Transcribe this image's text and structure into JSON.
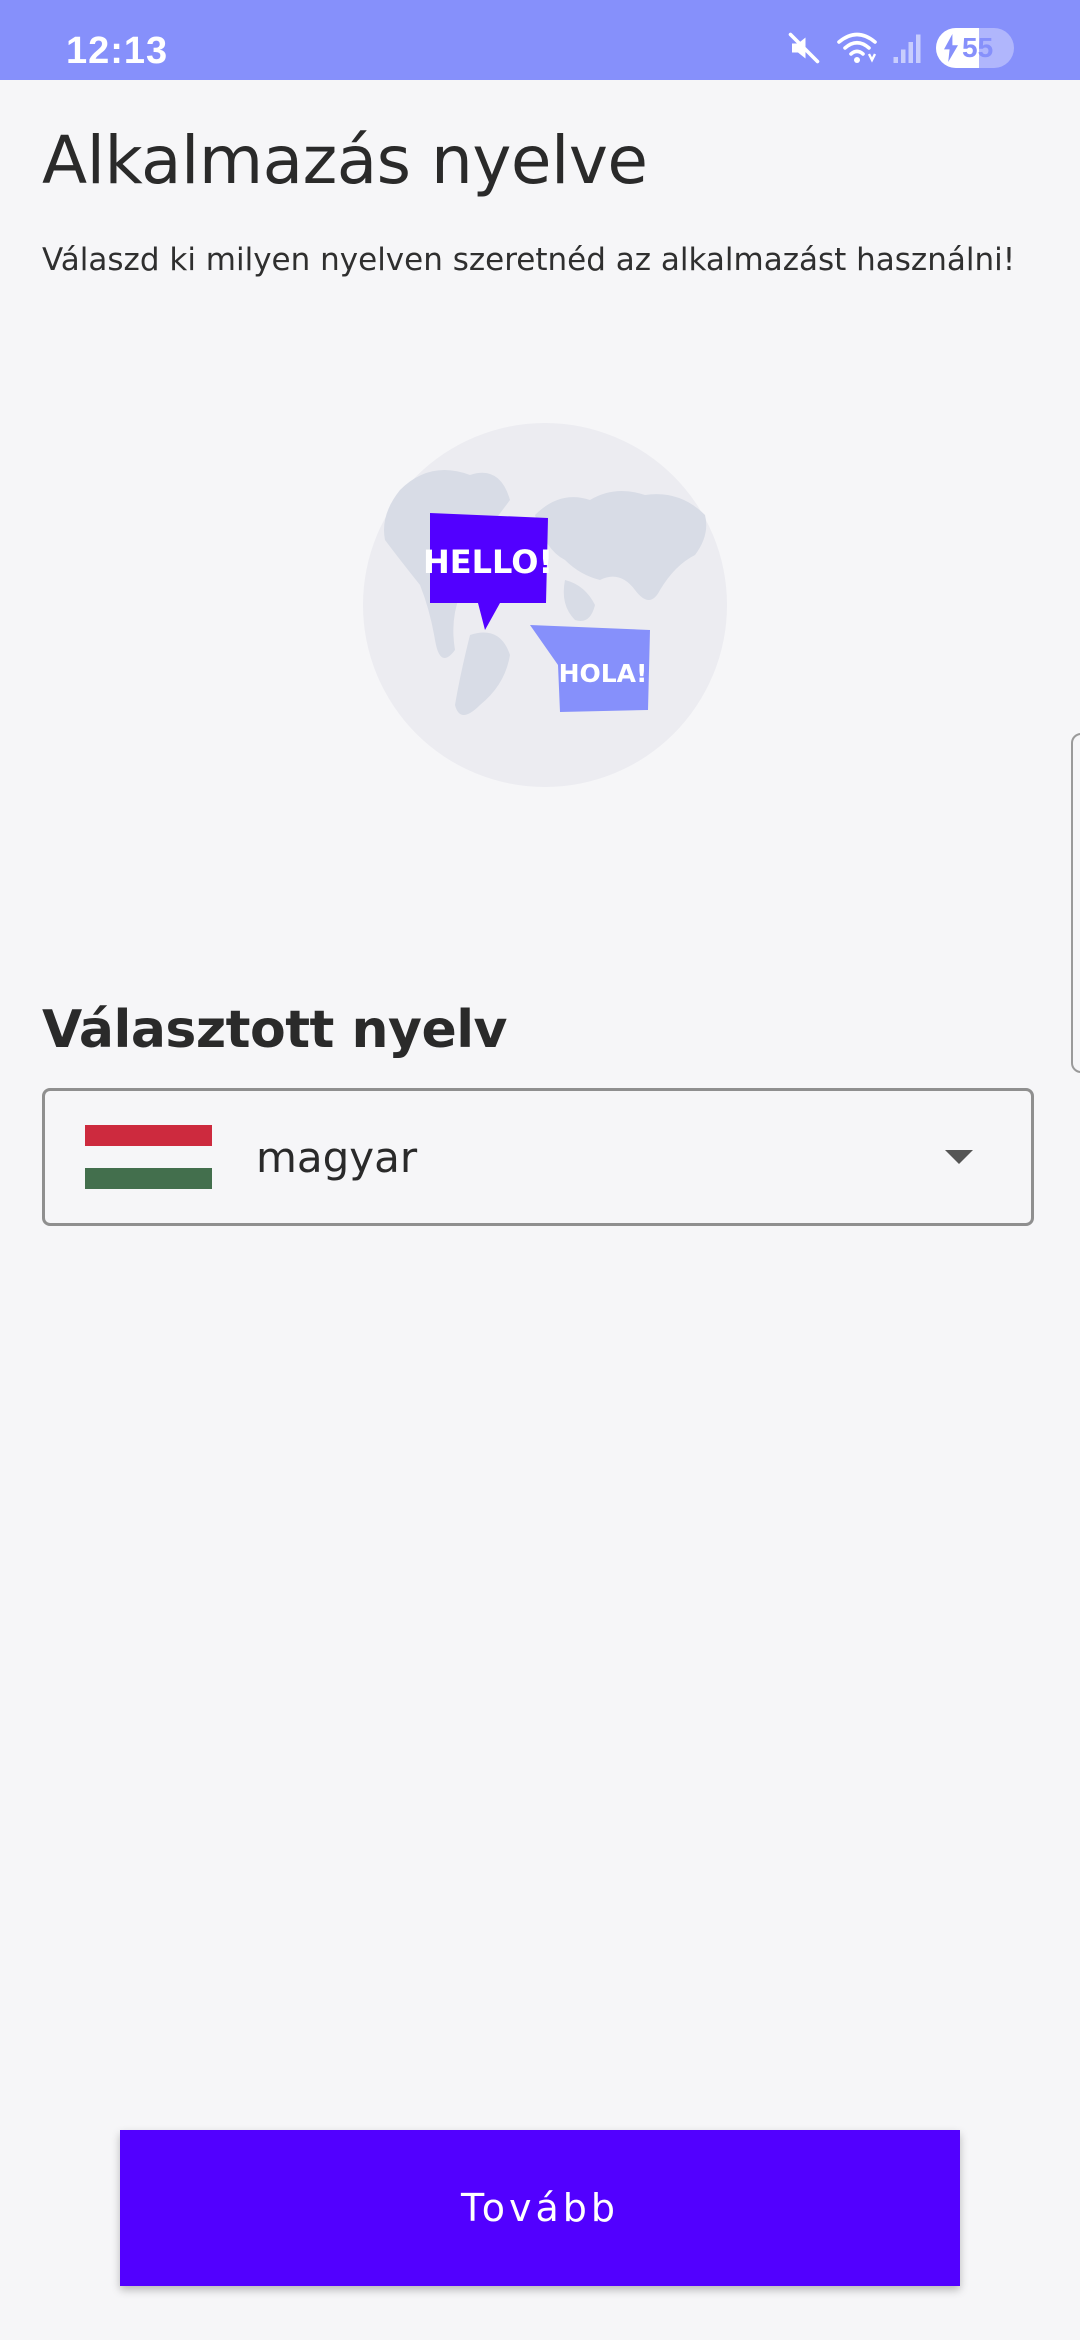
{
  "status_bar": {
    "time": "12:13",
    "icons": [
      "mute-icon",
      "wifi-icon",
      "signal-icon",
      "battery-icon"
    ],
    "battery_level": "55",
    "background": "#8690fb"
  },
  "page": {
    "title": "Alkalmazás nyelve",
    "subtitle": "Válaszd ki milyen nyelven szeretnéd az alkalmazást használni!"
  },
  "illustration": {
    "bubbles": [
      "HELLO!",
      "HOLA!"
    ],
    "colors": {
      "globe": "#ececf1",
      "land": "#d8dce6",
      "bubble_primary": "#5200ff",
      "bubble_secondary": "#8690fb"
    }
  },
  "language": {
    "heading": "Választott nyelv",
    "selected": "magyar",
    "flag_colors": [
      "#cd2a3e",
      "#f6f6f8",
      "#436f4d"
    ]
  },
  "actions": {
    "continue_label": "Tovább",
    "accent": "#5200ff"
  }
}
